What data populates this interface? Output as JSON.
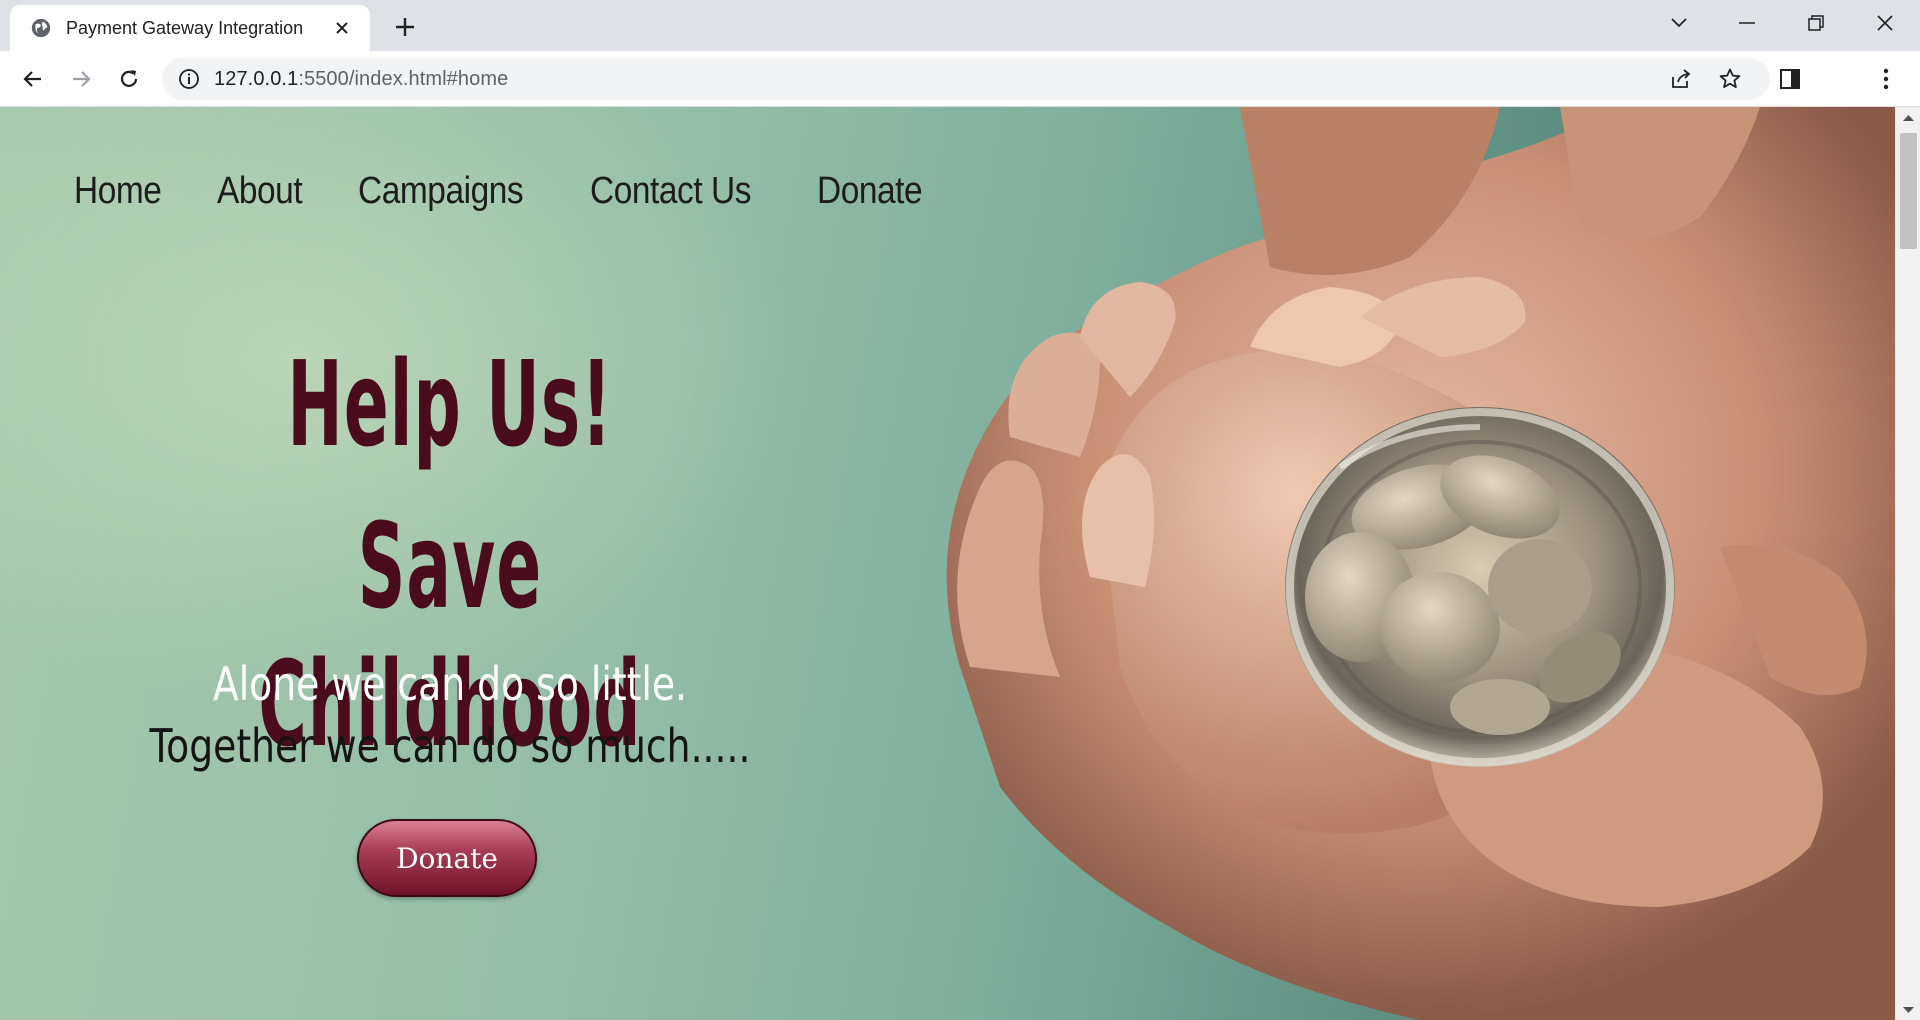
{
  "browser": {
    "tab_title": "Payment Gateway Integration",
    "url_host": "127.0.0.1",
    "url_path": ":5500/index.html#home"
  },
  "nav": {
    "items": [
      "Home",
      "About",
      "Campaigns",
      "Contact Us",
      "Donate"
    ]
  },
  "hero": {
    "title_line1": "Help Us!",
    "title_line2": "Save Childhood",
    "tagline_line1": "Alone we can do so little.",
    "tagline_line2": "Together we can do so much.....",
    "button_label": "Donate"
  },
  "colors": {
    "title": "#4a0c1c",
    "button": "#a83c55",
    "tagline_light": "#ffffff",
    "tagline_dark": "#141414"
  }
}
